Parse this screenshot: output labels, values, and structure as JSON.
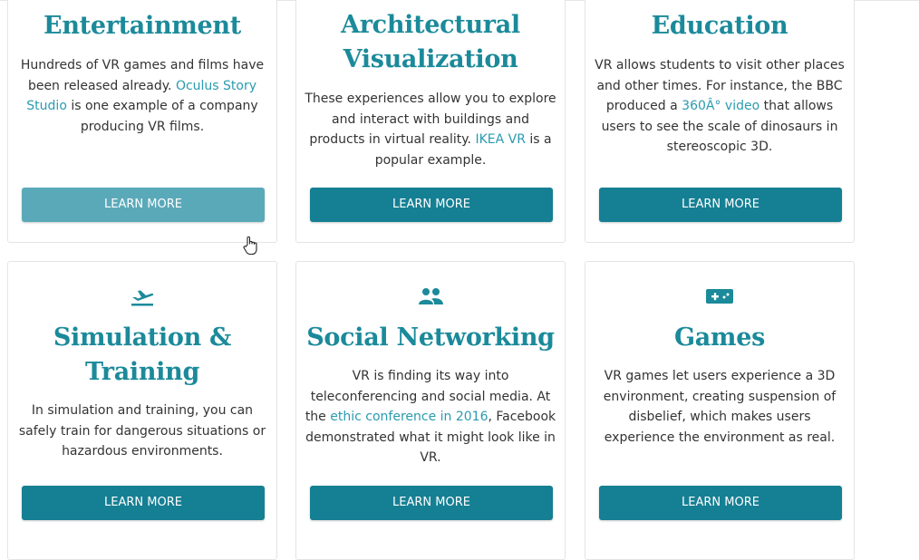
{
  "cards": [
    {
      "title_lines": [
        "Entertainment"
      ],
      "desc": [
        {
          "t": "Hundreds of VR games and films have been released already. "
        },
        {
          "t": "Oculus Story Studio",
          "link": true
        },
        {
          "t": " is one example of a company producing VR films."
        }
      ],
      "button": "LEARN MORE"
    },
    {
      "title_lines": [
        "Architectural",
        "Visualization"
      ],
      "desc": [
        {
          "t": "These experiences allow you to explore and interact with buildings and products in virtual reality. "
        },
        {
          "t": "IKEA VR",
          "link": true
        },
        {
          "t": " is a popular example."
        }
      ],
      "button": "LEARN MORE"
    },
    {
      "title_lines": [
        "Education"
      ],
      "desc": [
        {
          "t": "VR allows students to visit other places and other times. For instance, the BBC produced a "
        },
        {
          "t": "360Â° video",
          "link": true
        },
        {
          "t": " that allows users to see the scale of dinosaurs in stereoscopic 3D."
        }
      ],
      "button": "LEARN MORE"
    },
    {
      "icon": "airplane-takeoff-icon",
      "title_lines": [
        "Simulation &",
        "Training"
      ],
      "desc": [
        {
          "t": "In simulation and training, you can safely train for dangerous situations or hazardous environments."
        }
      ],
      "button": "LEARN MORE"
    },
    {
      "icon": "people-icon",
      "title_lines": [
        "Social Networking"
      ],
      "desc": [
        {
          "t": "VR is finding its way into teleconferencing and social media. At the "
        },
        {
          "t": "ethic conference in 2016",
          "link": true
        },
        {
          "t": ", Facebook demonstrated what it might look like in VR."
        }
      ],
      "button": "LEARN MORE"
    },
    {
      "icon": "gamepad-icon",
      "title_lines": [
        "Games"
      ],
      "desc": [
        {
          "t": "VR games let users experience a 3D environment, creating suspension of disbelief, which makes users experience the environment as real."
        }
      ],
      "button": "LEARN MORE"
    }
  ],
  "colors": {
    "accent": "#1b8a9a",
    "button": "#157f93",
    "button_hover": "#5aa9b9",
    "link": "#2a9bb0"
  }
}
